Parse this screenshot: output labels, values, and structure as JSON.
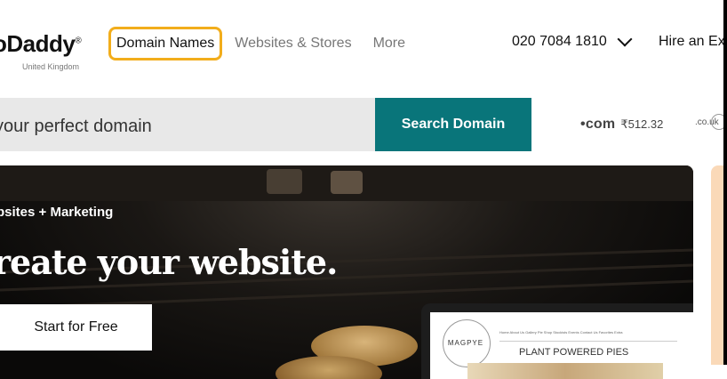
{
  "header": {
    "logo_text": "oDaddy",
    "logo_tm": "®",
    "logo_sub": "United Kingdom",
    "nav": [
      {
        "label": "Domain Names",
        "active": true
      },
      {
        "label": "Websites & Stores"
      },
      {
        "label": "More"
      }
    ],
    "phone": "020 7084 1810",
    "hire": "Hire an Exp"
  },
  "search": {
    "placeholder": "your perfect domain",
    "button": "Search Domain",
    "tlds": [
      {
        "name": "com",
        "price": "₹512.32"
      },
      {
        "name": ".co.uk"
      }
    ]
  },
  "hero": {
    "eyebrow": "bsites + Marketing",
    "title": "reate your website.",
    "cta": "Start for Free",
    "laptop": {
      "brand": "MAGPYE",
      "nav": "Home About Us Gallery Pie Shop Stockists Events Contact Us Favorites Extra",
      "headline": "PLANT POWERED PIES"
    }
  },
  "colors": {
    "accent_border": "#f2ad1b",
    "search_button": "#09757a",
    "side_panel": "#fad9b8"
  }
}
